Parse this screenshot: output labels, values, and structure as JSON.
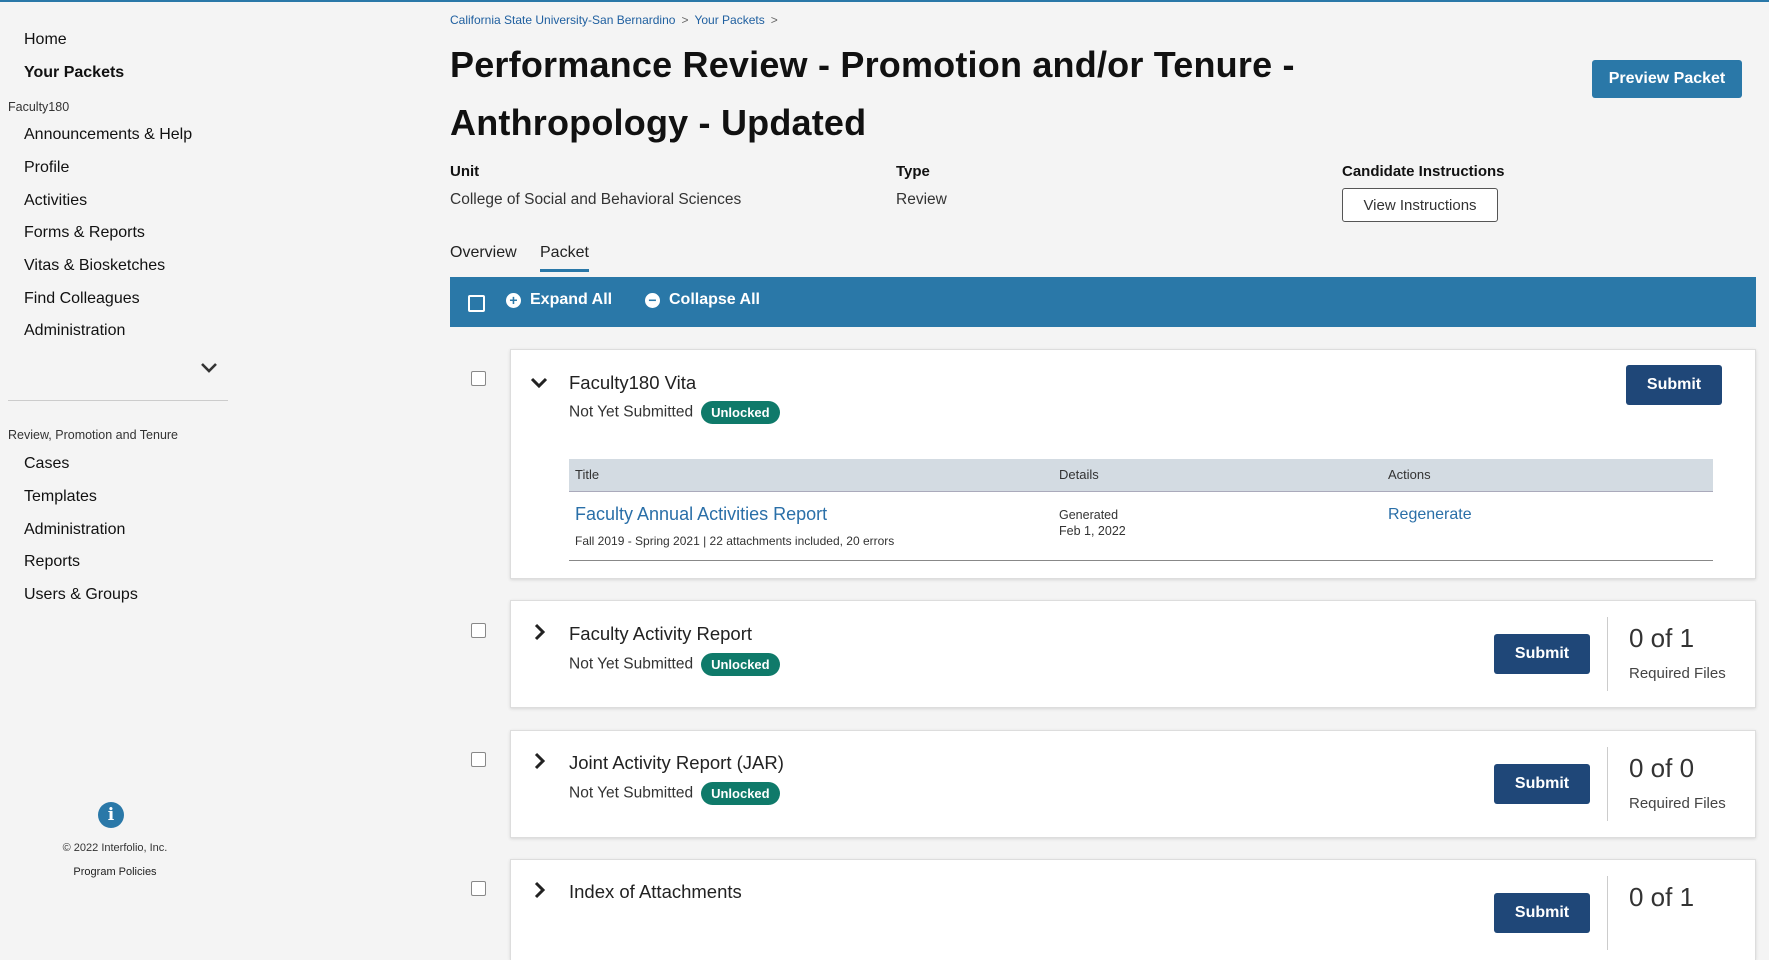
{
  "sidebar": {
    "home": "Home",
    "your_packets": "Your Packets",
    "section_faculty180": "Faculty180",
    "faculty_items": [
      "Announcements & Help",
      "Profile",
      "Activities",
      "Forms & Reports",
      "Vitas & Biosketches",
      "Find Colleagues"
    ],
    "administration": "Administration",
    "section_rpt": "Review, Promotion and Tenure",
    "rpt_items": [
      "Cases",
      "Templates",
      "Administration",
      "Reports",
      "Users & Groups"
    ],
    "info_icon": "info-icon",
    "copyright": "© 2022 Interfolio, Inc.",
    "program_policies": "Program Policies"
  },
  "breadcrumb": {
    "items": [
      "California State University-San Bernardino",
      "Your Packets"
    ],
    "separator": ">"
  },
  "page": {
    "title": "Performance Review - Promotion and/or Tenure - Anthropology - Updated",
    "preview_button": "Preview Packet"
  },
  "meta": {
    "unit_label": "Unit",
    "unit_value": "College of Social and Behavioral Sciences",
    "type_label": "Type",
    "type_value": "Review",
    "instructions_label": "Candidate Instructions",
    "instructions_button": "View Instructions"
  },
  "tabs": [
    "Overview",
    "Packet"
  ],
  "active_tab": "Packet",
  "toolbar": {
    "expand_all": "Expand All",
    "collapse_all": "Collapse All"
  },
  "sections": [
    {
      "title": "Faculty180 Vita",
      "status": "Not Yet Submitted",
      "badge": "Unlocked",
      "submit": "Submit",
      "expanded": true,
      "table": {
        "headers": [
          "Title",
          "Details",
          "Actions"
        ],
        "rows": [
          {
            "title": "Faculty Annual Activities Report",
            "subtitle": "Fall 2019 - Spring 2021 | 22 attachments included, 20 errors",
            "details": [
              "Generated",
              "Feb 1, 2022"
            ],
            "action": "Regenerate"
          }
        ]
      }
    },
    {
      "title": "Faculty Activity Report",
      "status": "Not Yet Submitted",
      "badge": "Unlocked",
      "submit": "Submit",
      "count": "0 of 1",
      "count_label": "Required Files"
    },
    {
      "title": "Joint Activity Report (JAR)",
      "status": "Not Yet Submitted",
      "badge": "Unlocked",
      "submit": "Submit",
      "count": "0 of 0",
      "count_label": "Required Files"
    },
    {
      "title": "Index of Attachments",
      "submit": "Submit",
      "count": "0 of 1"
    }
  ],
  "colors": {
    "accent": "#2a78a8",
    "submit": "#1f4778",
    "badge": "#0f7a6a",
    "link": "#2a6fa8"
  }
}
